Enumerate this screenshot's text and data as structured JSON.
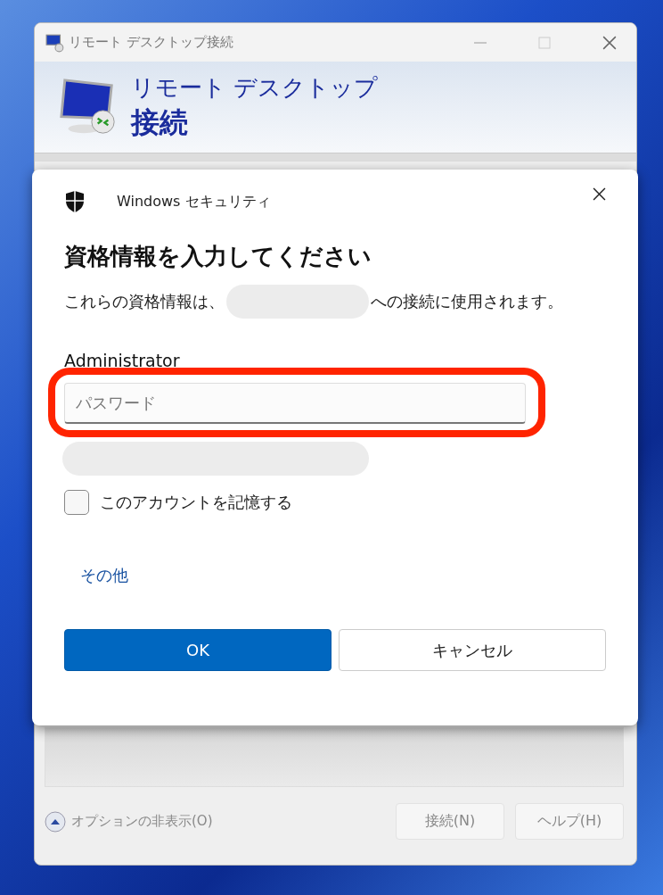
{
  "window": {
    "title": "リモート デスクトップ接続",
    "banner_line_1": "リモート デスクトップ",
    "banner_line_2": "接続"
  },
  "footer": {
    "options_toggle": "オプションの非表示(O)",
    "buttons": [
      {
        "label": "接続(N)"
      },
      {
        "label": "ヘルプ(H)"
      }
    ]
  },
  "dialog": {
    "app_name": "Windows セキュリティ",
    "heading": "資格情報を入力してください",
    "message_before": "これらの資格情報は、",
    "message_after": "への接続に使用されます。",
    "username": "Administrator",
    "password": {
      "placeholder": "パスワード",
      "highlighted": true
    },
    "remember": {
      "label": "このアカウントを記憶する",
      "checked": false
    },
    "more_link": "その他",
    "buttons": [
      {
        "label": "OK",
        "kind": "primary"
      },
      {
        "label": "キャンセル",
        "kind": "secondary"
      }
    ]
  }
}
